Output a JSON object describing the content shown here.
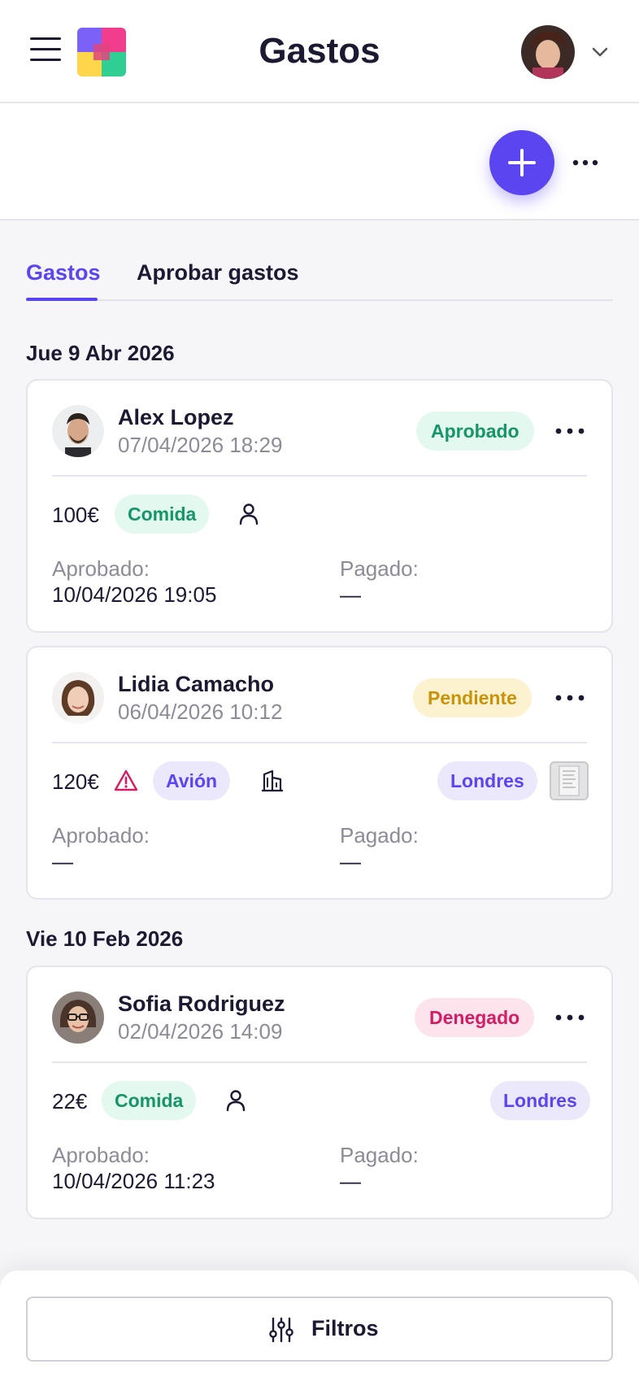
{
  "header": {
    "title": "Gastos",
    "logo_colors": [
      "#7b61f7",
      "#f23c8e",
      "#ffd54a",
      "#2fcf93"
    ]
  },
  "tabs": [
    {
      "label": "Gastos",
      "active": true
    },
    {
      "label": "Aprobar gastos",
      "active": false
    }
  ],
  "groups": [
    {
      "date": "Jue 9 Abr 2026",
      "expenses": [
        {
          "name": "Alex Lopez",
          "datetime": "07/04/2026 18:29",
          "status": "Aprobado",
          "amount": "100€",
          "category": "Comida",
          "type_icon": "person-icon",
          "approved_label": "Aprobado:",
          "approved_value": "10/04/2026 19:05",
          "paid_label": "Pagado:",
          "paid_value": "—"
        },
        {
          "name": "Lidia Camacho",
          "datetime": "06/04/2026 10:12",
          "status": "Pendiente",
          "amount": "120€",
          "warning_icon": "warning-icon",
          "category": "Avión",
          "type_icon": "building-icon",
          "location": "Londres",
          "receipt_icon": "receipt-thumbnail",
          "approved_label": "Aprobado:",
          "approved_value": "—",
          "paid_label": "Pagado:",
          "paid_value": "—"
        }
      ]
    },
    {
      "date": "Vie 10 Feb 2026",
      "expenses": [
        {
          "name": "Sofia Rodriguez",
          "datetime": "02/04/2026 14:09",
          "status": "Denegado",
          "amount": "22€",
          "category": "Comida",
          "type_icon": "person-icon",
          "location": "Londres",
          "approved_label": "Aprobado:",
          "approved_value": "10/04/2026 11:23",
          "paid_label": "Pagado:",
          "paid_value": "—"
        }
      ]
    }
  ],
  "filters": {
    "label": "Filtros"
  },
  "colors": {
    "accent": "#5a45f0",
    "approved": "#17956a",
    "pending": "#c8930a",
    "denied": "#d61c64"
  }
}
